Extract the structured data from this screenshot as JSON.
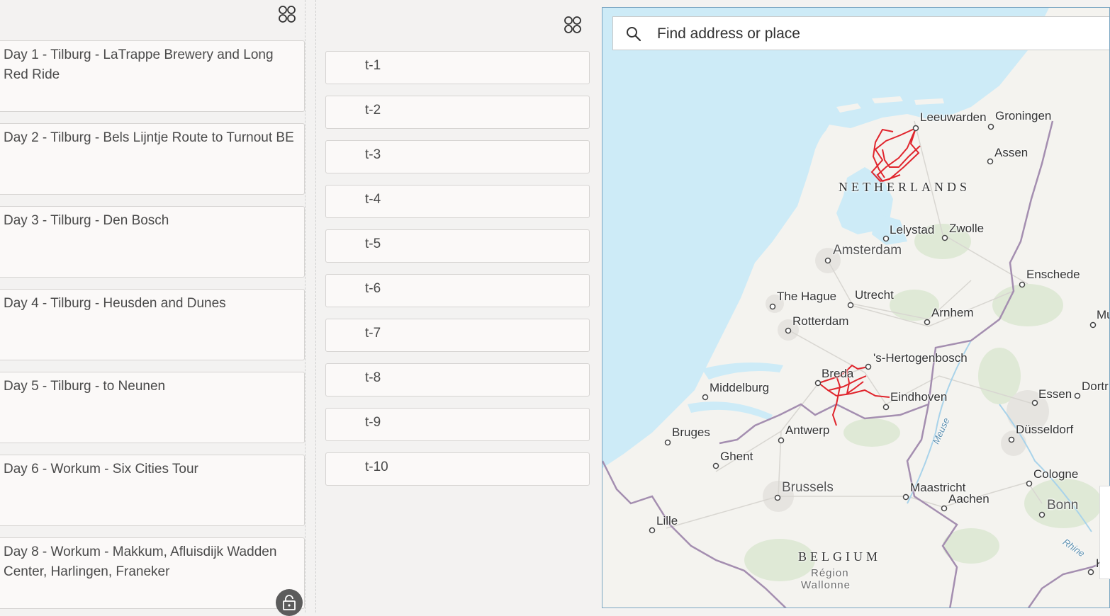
{
  "days": [
    {
      "label": "Day 1 - Tilburg - LaTrappe Brewery and Long Red Ride"
    },
    {
      "label": "Day 2 - Tilburg - Bels Lijntje Route to Turnout BE"
    },
    {
      "label": "Day 3 - Tilburg - Den Bosch"
    },
    {
      "label": "Day 4 - Tilburg - Heusden and Dunes"
    },
    {
      "label": "Day 5 - Tilburg - to Neunen"
    },
    {
      "label": "Day 6 - Workum - Six Cities Tour"
    },
    {
      "label": "Day 8 - Workum - Makkum, Afluisdijk Wadden Center, Harlingen, Franeker"
    }
  ],
  "tracks": [
    "t-1",
    "t-2",
    "t-3",
    "t-4",
    "t-5",
    "t-6",
    "t-7",
    "t-8",
    "t-9",
    "t-10"
  ],
  "search": {
    "placeholder": "Find address or place"
  },
  "map": {
    "route_color": "#e0242c",
    "water_color": "#cdebf7",
    "border_color": "#a48eb0",
    "labels": {
      "leeuwarden": "Leeuwarden",
      "groningen": "Groningen",
      "assen": "Assen",
      "netherlands": "NETHERLANDS",
      "lelystad": "Lelystad",
      "zwolle": "Zwolle",
      "amsterdam": "Amsterdam",
      "enschede": "Enschede",
      "the_hague": "The Hague",
      "utrecht": "Utrecht",
      "arnhem": "Arnhem",
      "rotterdam": "Rotterdam",
      "hertogenbosch": "'s-Hertogenbosch",
      "breda": "Breda",
      "middelburg": "Middelburg",
      "eindhoven": "Eindhoven",
      "essen": "Essen",
      "dortmund": "Dortr",
      "bruges": "Bruges",
      "antwerp": "Antwerp",
      "meuse": "Meuse",
      "dusseldorf": "Düsseldorf",
      "ghent": "Ghent",
      "cologne": "Cologne",
      "brussels": "Brussels",
      "maastricht": "Maastricht",
      "aachen": "Aachen",
      "bonn": "Bonn",
      "lille": "Lille",
      "belgium": "BELGIUM",
      "region": "Région",
      "wallonne": "Wallonne",
      "rhine": "Rhine",
      "mu": "Mu",
      "koln": "Kol"
    }
  }
}
